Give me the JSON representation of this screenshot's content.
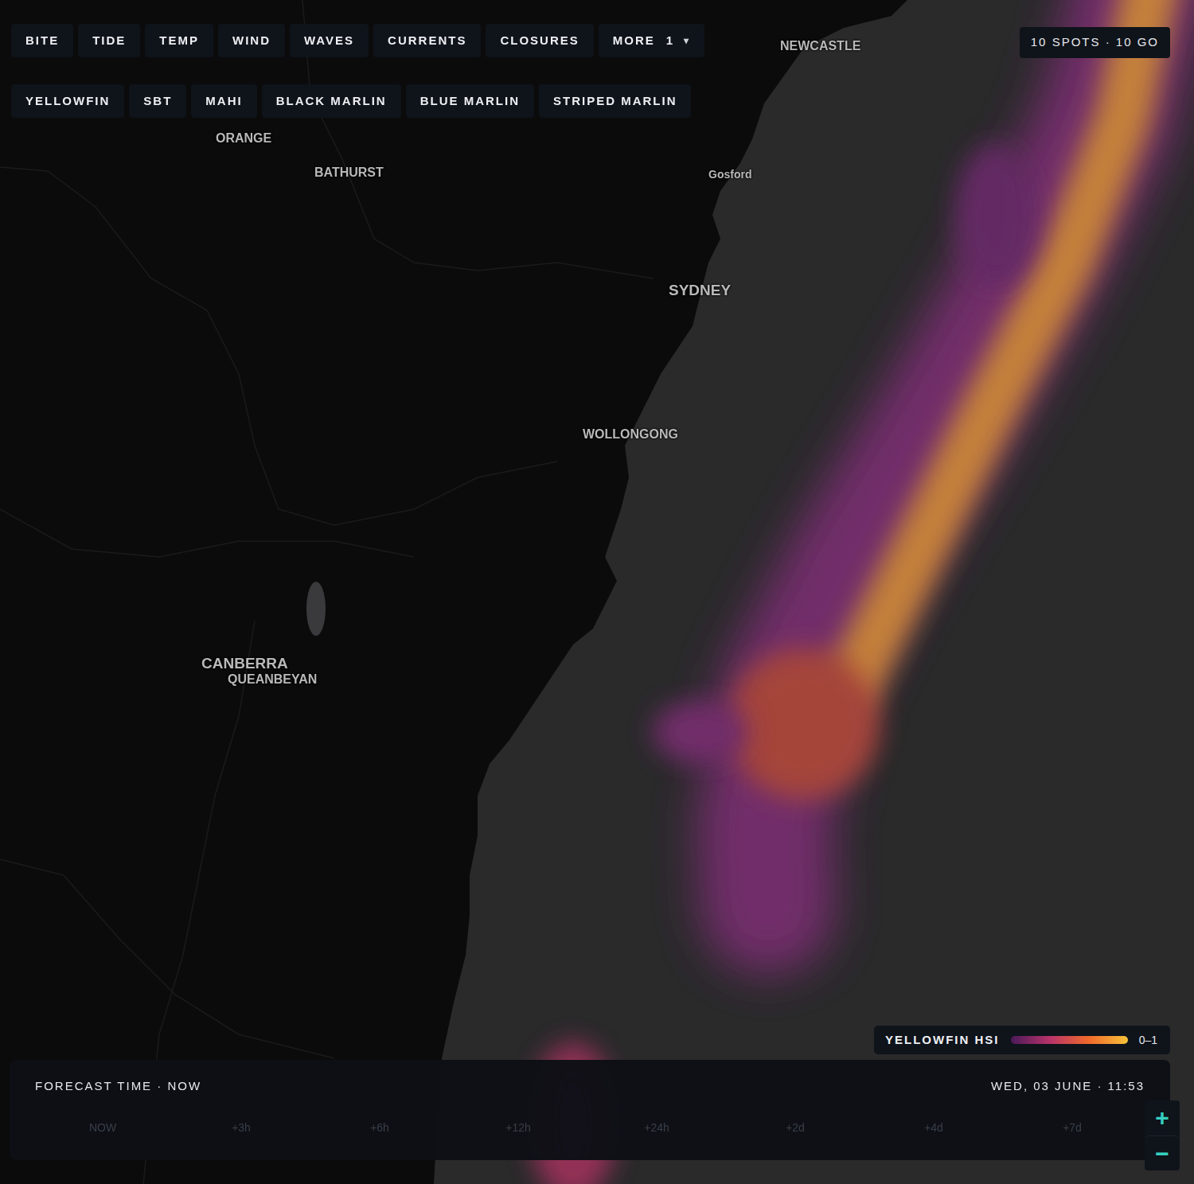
{
  "toolbar": {
    "layers": [
      {
        "label": "BITE"
      },
      {
        "label": "TIDE"
      },
      {
        "label": "TEMP"
      },
      {
        "label": "WIND"
      },
      {
        "label": "WAVES"
      },
      {
        "label": "CURRENTS"
      },
      {
        "label": "CLOSURES"
      }
    ],
    "more": {
      "label": "MORE",
      "count": "1",
      "caret": "▾"
    }
  },
  "species": [
    {
      "label": "YELLOWFIN",
      "selected": false
    },
    {
      "label": "SBT",
      "selected": false
    },
    {
      "label": "MAHI",
      "selected": false
    },
    {
      "label": "BLACK MARLIN",
      "selected": false
    },
    {
      "label": "BLUE MARLIN",
      "selected": false
    },
    {
      "label": "STRIPED MARLIN",
      "selected": false
    }
  ],
  "spots_badge": "10 SPOTS · 10 GO",
  "map": {
    "labels": [
      {
        "text": "NEWCASTLE",
        "kind": "city"
      },
      {
        "text": "ORANGE",
        "kind": "city"
      },
      {
        "text": "BATHURST",
        "kind": "city"
      },
      {
        "text": "Gosford",
        "kind": "town"
      },
      {
        "text": "SYDNEY",
        "kind": "major"
      },
      {
        "text": "WOLLONGONG",
        "kind": "city"
      },
      {
        "text": "CANBERRA",
        "kind": "major"
      },
      {
        "text": "QUEANBEYAN",
        "kind": "city"
      }
    ]
  },
  "legend": {
    "title": "YELLOWFIN HSI",
    "range": "0–1"
  },
  "timeline": {
    "title": "FORECAST TIME · NOW",
    "datetime": "WED, 03 JUNE · 11:53",
    "ticks": [
      "NOW",
      "+3h",
      "+6h",
      "+12h",
      "+24h",
      "+2d",
      "+4d",
      "+7d"
    ]
  },
  "zoom": {
    "in": "+",
    "out": "−"
  }
}
